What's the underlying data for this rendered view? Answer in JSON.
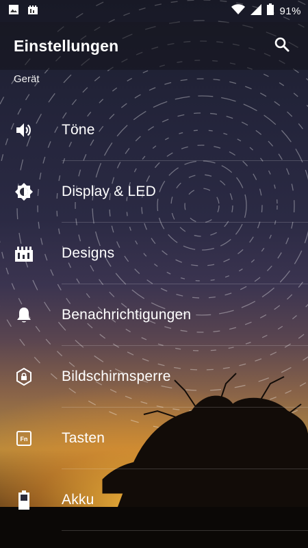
{
  "status_bar": {
    "battery_percent": "91%",
    "left_icons": [
      "image-icon",
      "theme-icon"
    ],
    "right_icons": [
      "wifi-icon",
      "signal-icon",
      "battery-icon"
    ]
  },
  "toolbar": {
    "title": "Einstellungen",
    "search_icon": "search-icon"
  },
  "section": {
    "header": "Gerät"
  },
  "items": [
    {
      "label": "Töne",
      "icon": "volume-icon"
    },
    {
      "label": "Display & LED",
      "icon": "brightness-icon"
    },
    {
      "label": "Designs",
      "icon": "theme-icon"
    },
    {
      "label": "Benachrichtigungen",
      "icon": "bell-icon"
    },
    {
      "label": "Bildschirmsperre",
      "icon": "lock-icon"
    },
    {
      "label": "Tasten",
      "icon": "fn-key-icon"
    },
    {
      "label": "Akku",
      "icon": "battery-icon"
    }
  ]
}
